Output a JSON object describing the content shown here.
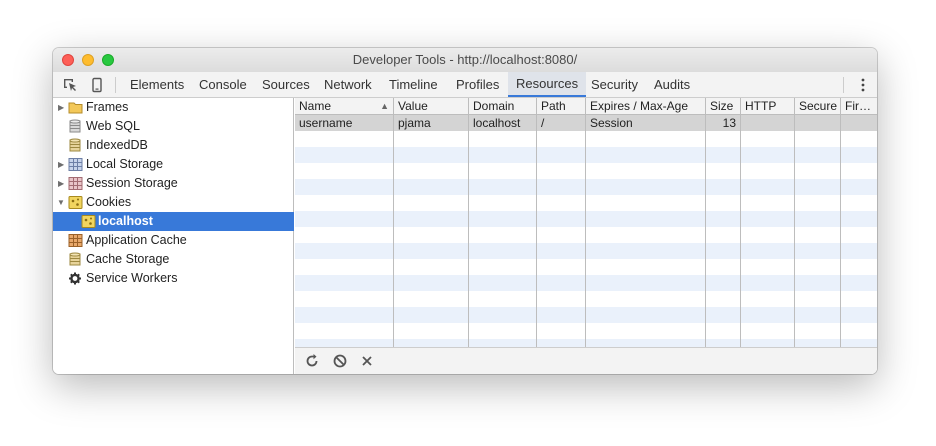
{
  "window": {
    "title": "Developer Tools - http://localhost:8080/"
  },
  "toolbar": {
    "tabs": [
      "Elements",
      "Console",
      "Sources",
      "Network",
      "Timeline",
      "Profiles",
      "Resources",
      "Security",
      "Audits"
    ],
    "active_tab": "Resources"
  },
  "sidebar": {
    "items": [
      {
        "label": "Frames"
      },
      {
        "label": "Web SQL"
      },
      {
        "label": "IndexedDB"
      },
      {
        "label": "Local Storage"
      },
      {
        "label": "Session Storage"
      },
      {
        "label": "Cookies"
      },
      {
        "label": "localhost"
      },
      {
        "label": "Application Cache"
      },
      {
        "label": "Cache Storage"
      },
      {
        "label": "Service Workers"
      }
    ],
    "selected": "localhost"
  },
  "cookies_table": {
    "columns": [
      "Name",
      "Value",
      "Domain",
      "Path",
      "Expires / Max-Age",
      "Size",
      "HTTP",
      "Secure",
      "Fir…"
    ],
    "sorted_by": "Name",
    "rows": [
      {
        "name": "username",
        "value": "pjama",
        "domain": "localhost",
        "path": "/",
        "expires": "Session",
        "size": "13",
        "http": "",
        "secure": "",
        "first_party": ""
      }
    ]
  },
  "colors": {
    "selection": "#3879d9",
    "row_stripe": "#eaf1fb",
    "selected_row": "#d4d4d4"
  }
}
